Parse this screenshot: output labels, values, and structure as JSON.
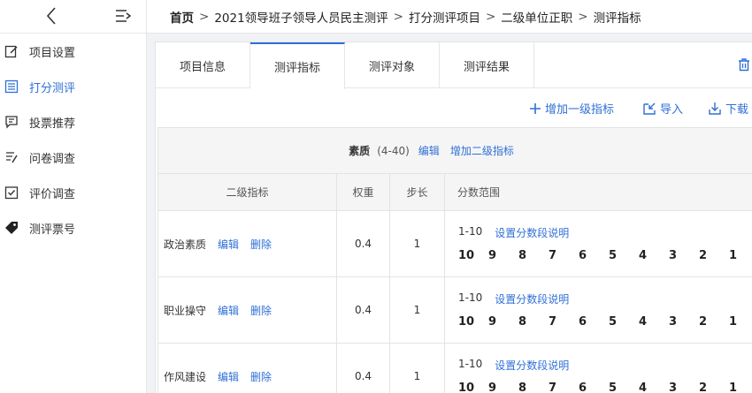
{
  "sidebar": {
    "items": [
      {
        "label": "项目设置",
        "icon": "edit-icon",
        "active": false
      },
      {
        "label": "打分测评",
        "icon": "scoring-icon",
        "active": true
      },
      {
        "label": "投票推荐",
        "icon": "vote-icon",
        "active": false
      },
      {
        "label": "问卷调查",
        "icon": "survey-icon",
        "active": false
      },
      {
        "label": "评价调查",
        "icon": "review-icon",
        "active": false
      },
      {
        "label": "测评票号",
        "icon": "ticket-tag-icon",
        "active": false
      }
    ]
  },
  "breadcrumb": [
    "首页",
    "2021领导班子领导人员民主测评",
    "打分测评项目",
    "二级单位正职",
    "测评指标"
  ],
  "tabs": [
    {
      "label": "项目信息",
      "active": false
    },
    {
      "label": "测评指标",
      "active": true
    },
    {
      "label": "测评对象",
      "active": false
    },
    {
      "label": "测评结果",
      "active": false
    }
  ],
  "actions": {
    "add_level1": "增加一级指标",
    "import": "导入",
    "download": "下载"
  },
  "group": {
    "name": "素质",
    "range": "(4-40)",
    "edit": "编辑",
    "add_level2": "增加二级指标"
  },
  "columns": {
    "indicator": "二级指标",
    "weight": "权重",
    "step": "步长",
    "score_range": "分数范围"
  },
  "rows": [
    {
      "name": "政治素质",
      "edit": "编辑",
      "delete": "删除",
      "weight": "0.4",
      "step": "1",
      "range": "1-10",
      "range_link": "设置分数段说明",
      "scores": [
        "10",
        "9",
        "8",
        "7",
        "6",
        "5",
        "4",
        "3",
        "2",
        "1"
      ]
    },
    {
      "name": "职业操守",
      "edit": "编辑",
      "delete": "删除",
      "weight": "0.4",
      "step": "1",
      "range": "1-10",
      "range_link": "设置分数段说明",
      "scores": [
        "10",
        "9",
        "8",
        "7",
        "6",
        "5",
        "4",
        "3",
        "2",
        "1"
      ]
    },
    {
      "name": "作风建设",
      "edit": "编辑",
      "delete": "删除",
      "weight": "0.4",
      "step": "1",
      "range": "1-10",
      "range_link": "设置分数段说明",
      "scores": [
        "10",
        "9",
        "8",
        "7",
        "6",
        "5",
        "4",
        "3",
        "2",
        "1"
      ]
    }
  ],
  "colors": {
    "accent": "#2f6fd6",
    "text": "#333333",
    "header_bg": "#f5f5f5"
  }
}
